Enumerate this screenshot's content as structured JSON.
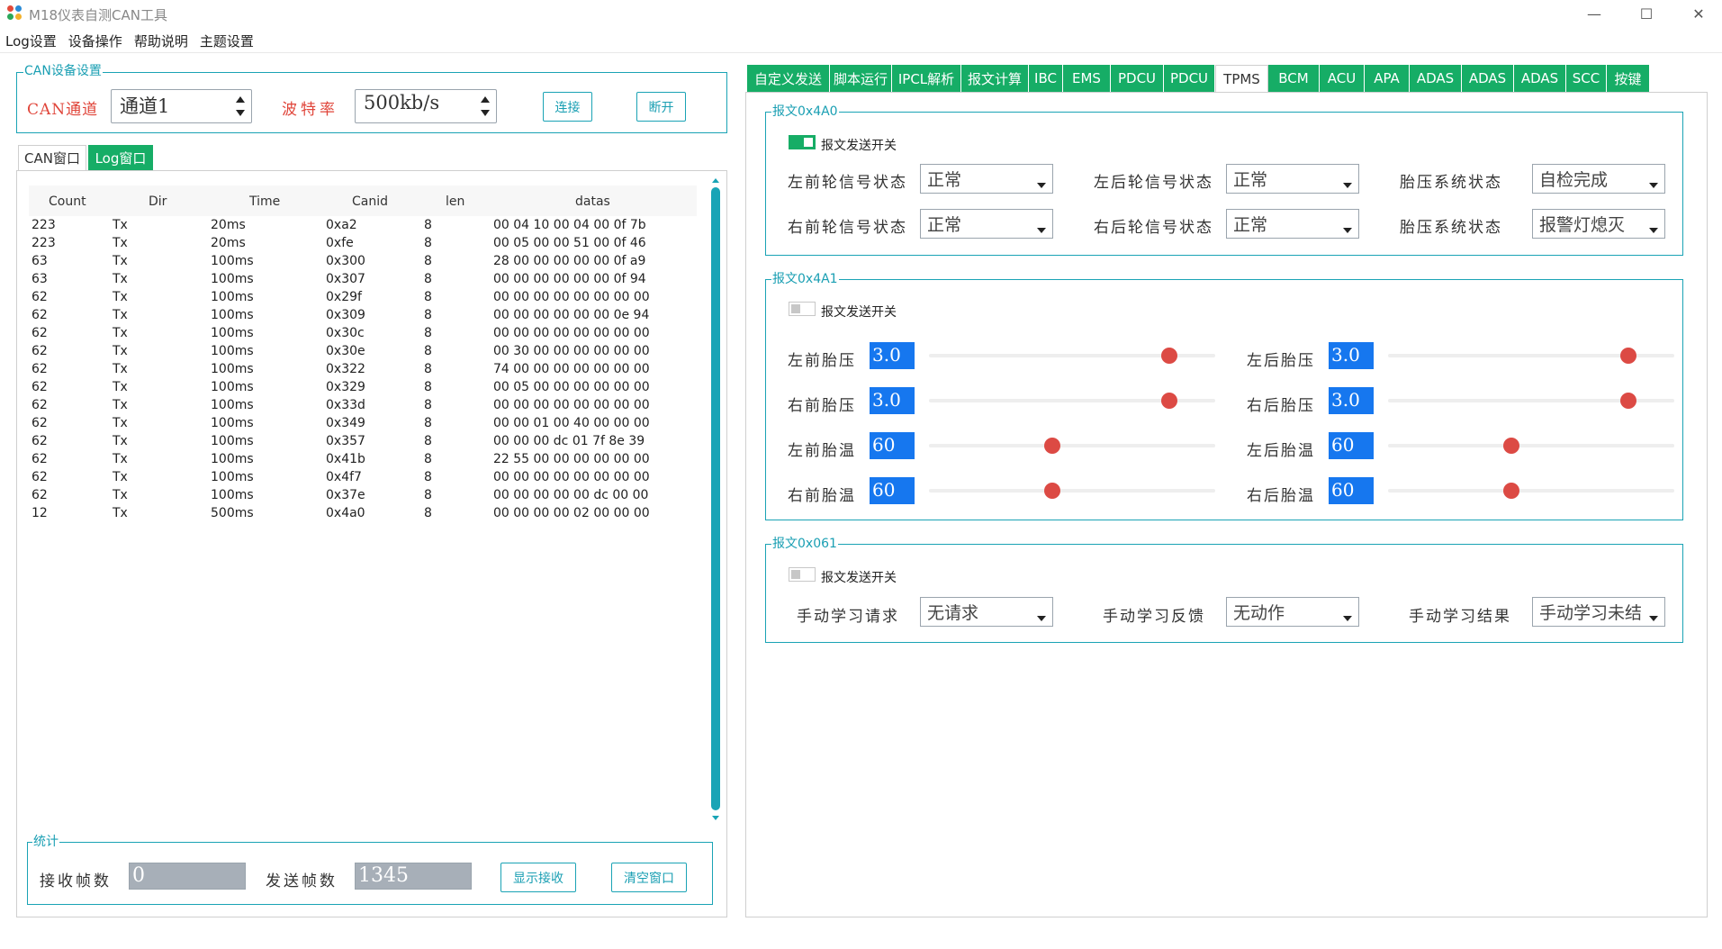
{
  "window": {
    "title": "M18仪表自测CAN工具",
    "minimize_icon": "—",
    "maximize_icon": "☐",
    "close_icon": "✕"
  },
  "menu": [
    "Log设置",
    "设备操作",
    "帮助说明",
    "主题设置"
  ],
  "can_settings": {
    "title": "CAN设备设置",
    "channel_label": "CAN通道",
    "channel_value": "通道1",
    "baud_label": "波特率",
    "baud_value": "500kb/s",
    "connect_label": "连接",
    "disconnect_label": "断开"
  },
  "left_tabs": [
    "CAN窗口",
    "Log窗口"
  ],
  "table": {
    "columns": [
      "Count",
      "Dir",
      "Time",
      "Canid",
      "len",
      "datas"
    ],
    "rows": [
      [
        "223",
        "Tx",
        "20ms",
        "0xa2",
        "8",
        "00 04 10 00 04 00 0f 7b"
      ],
      [
        "223",
        "Tx",
        "20ms",
        "0xfe",
        "8",
        "00 05 00 00 51 00 0f 46"
      ],
      [
        "63",
        "Tx",
        "100ms",
        "0x300",
        "8",
        "28 00 00 00 00 00 0f a9"
      ],
      [
        "63",
        "Tx",
        "100ms",
        "0x307",
        "8",
        "00 00 00 00 00 00 0f 94"
      ],
      [
        "62",
        "Tx",
        "100ms",
        "0x29f",
        "8",
        "00 00 00 00 00 00 00 00"
      ],
      [
        "62",
        "Tx",
        "100ms",
        "0x309",
        "8",
        "00 00 00 00 00 00 0e 94"
      ],
      [
        "62",
        "Tx",
        "100ms",
        "0x30c",
        "8",
        "00 00 00 00 00 00 00 00"
      ],
      [
        "62",
        "Tx",
        "100ms",
        "0x30e",
        "8",
        "00 30 00 00 00 00 00 00"
      ],
      [
        "62",
        "Tx",
        "100ms",
        "0x322",
        "8",
        "74 00 00 00 00 00 00 00"
      ],
      [
        "62",
        "Tx",
        "100ms",
        "0x329",
        "8",
        "00 05 00 00 00 00 00 00"
      ],
      [
        "62",
        "Tx",
        "100ms",
        "0x33d",
        "8",
        "00 00 00 00 00 00 00 00"
      ],
      [
        "62",
        "Tx",
        "100ms",
        "0x349",
        "8",
        "00 00 01 00 40 00 00 00"
      ],
      [
        "62",
        "Tx",
        "100ms",
        "0x357",
        "8",
        "00 00 00 dc 01 7f 8e 39"
      ],
      [
        "62",
        "Tx",
        "100ms",
        "0x41b",
        "8",
        "22 55 00 00 00 00 00 00"
      ],
      [
        "62",
        "Tx",
        "100ms",
        "0x4f7",
        "8",
        "00 00 00 00 00 00 00 00"
      ],
      [
        "62",
        "Tx",
        "100ms",
        "0x37e",
        "8",
        "00 00 00 00 00 dc 00 00"
      ],
      [
        "12",
        "Tx",
        "500ms",
        "0x4a0",
        "8",
        "00 00 00 00 02 00 00 00"
      ]
    ]
  },
  "stats": {
    "title": "统计",
    "recv_label": "接收帧数",
    "recv_value": "0",
    "send_label": "发送帧数",
    "send_value": "1345",
    "show_recv_label": "显示接收",
    "clear_label": "清空窗口"
  },
  "right_tabs": [
    "自定义发送",
    "脚本运行",
    "IPCL解析",
    "报文计算",
    "IBC",
    "EMS",
    "PDCU",
    "PDCU",
    "TPMS",
    "BCM",
    "ACU",
    "APA",
    "ADAS",
    "ADAS",
    "ADAS",
    "SCC",
    "按键"
  ],
  "active_right_tab": "TPMS",
  "msg_4a0": {
    "title": "报文0x4A0",
    "switch_label": "报文发送开关",
    "switch_on": true,
    "fields": [
      {
        "label": "左前轮信号状态",
        "value": "正常"
      },
      {
        "label": "左后轮信号状态",
        "value": "正常"
      },
      {
        "label": "胎压系统状态",
        "value": "自检完成"
      },
      {
        "label": "右前轮信号状态",
        "value": "正常"
      },
      {
        "label": "右后轮信号状态",
        "value": "正常"
      },
      {
        "label": "胎压系统状态",
        "value": "报警灯熄灭"
      }
    ]
  },
  "msg_4a1": {
    "title": "报文0x4A1",
    "switch_label": "报文发送开关",
    "switch_on": false,
    "sliders": [
      {
        "label": "左前胎压",
        "value": "3.0",
        "level": 0.84
      },
      {
        "label": "左后胎压",
        "value": "3.0",
        "level": 0.84
      },
      {
        "label": "右前胎压",
        "value": "3.0",
        "level": 0.84
      },
      {
        "label": "右后胎压",
        "value": "3.0",
        "level": 0.84
      },
      {
        "label": "左前胎温",
        "value": "60",
        "level": 0.43
      },
      {
        "label": "左后胎温",
        "value": "60",
        "level": 0.43
      },
      {
        "label": "右前胎温",
        "value": "60",
        "level": 0.43
      },
      {
        "label": "右后胎温",
        "value": "60",
        "level": 0.43
      }
    ]
  },
  "msg_061": {
    "title": "报文0x061",
    "switch_label": "报文发送开关",
    "switch_on": false,
    "fields": [
      {
        "label": "手动学习请求",
        "value": "无请求"
      },
      {
        "label": "手动学习反馈",
        "value": "无动作"
      },
      {
        "label": "手动学习结果",
        "value": "手动学习未结"
      }
    ]
  },
  "colors": {
    "accent_teal": "#1aa3b5",
    "tab_green": "#16ad66",
    "value_blue": "#1677ef",
    "slider_red": "#dc4a44",
    "label_red": "#e0453a"
  }
}
